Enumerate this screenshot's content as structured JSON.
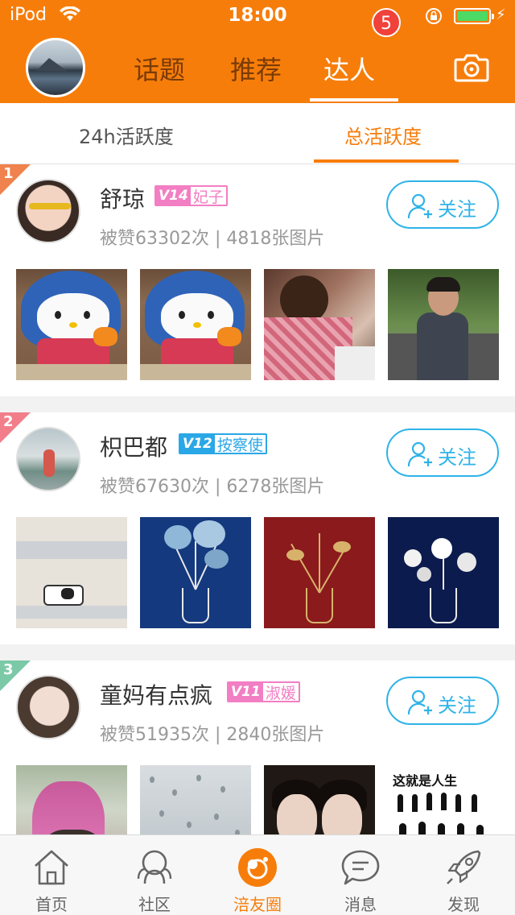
{
  "status_bar": {
    "carrier": "iPod",
    "time": "18:00"
  },
  "header": {
    "tabs": [
      {
        "label": "话题"
      },
      {
        "label": "推荐"
      },
      {
        "label": "达人"
      }
    ],
    "active_tab": "达人"
  },
  "subtabs": [
    {
      "label": "24h活跃度"
    },
    {
      "label": "总活跃度"
    }
  ],
  "active_subtab": "总活跃度",
  "users": [
    {
      "rank": "1",
      "name": "舒琼",
      "level": "V14",
      "title": "妃子",
      "badge_color": "#f27ec3",
      "stats": "被赞63302次 | 4818张图片",
      "follow_label": "关注",
      "rank_color": "#f0824d"
    },
    {
      "rank": "2",
      "name": "枳巴都",
      "level": "V12",
      "title": "按察使",
      "badge_color": "#2aa7e6",
      "stats": "被赞67630次 | 6278张图片",
      "follow_label": "关注",
      "rank_color": "#f27e8a"
    },
    {
      "rank": "3",
      "name": "童妈有点疯",
      "level": "V11",
      "title": "淑媛",
      "badge_color": "#f27ec3",
      "stats": "被赞51935次 | 2840张图片",
      "follow_label": "关注",
      "rank_color": "#7cc9a8"
    }
  ],
  "poster_text": "这就是人生",
  "bottom_tabs": [
    {
      "label": "首页",
      "icon": "home-icon"
    },
    {
      "label": "社区",
      "icon": "community-icon"
    },
    {
      "label": "涪友圈",
      "icon": "friends-circle-icon"
    },
    {
      "label": "消息",
      "icon": "message-icon"
    },
    {
      "label": "发现",
      "icon": "rocket-icon"
    }
  ],
  "active_bottom_tab": "涪友圈",
  "message_badge": "5",
  "colors": {
    "brand": "#f77d0a",
    "follow": "#2fb3e8"
  }
}
